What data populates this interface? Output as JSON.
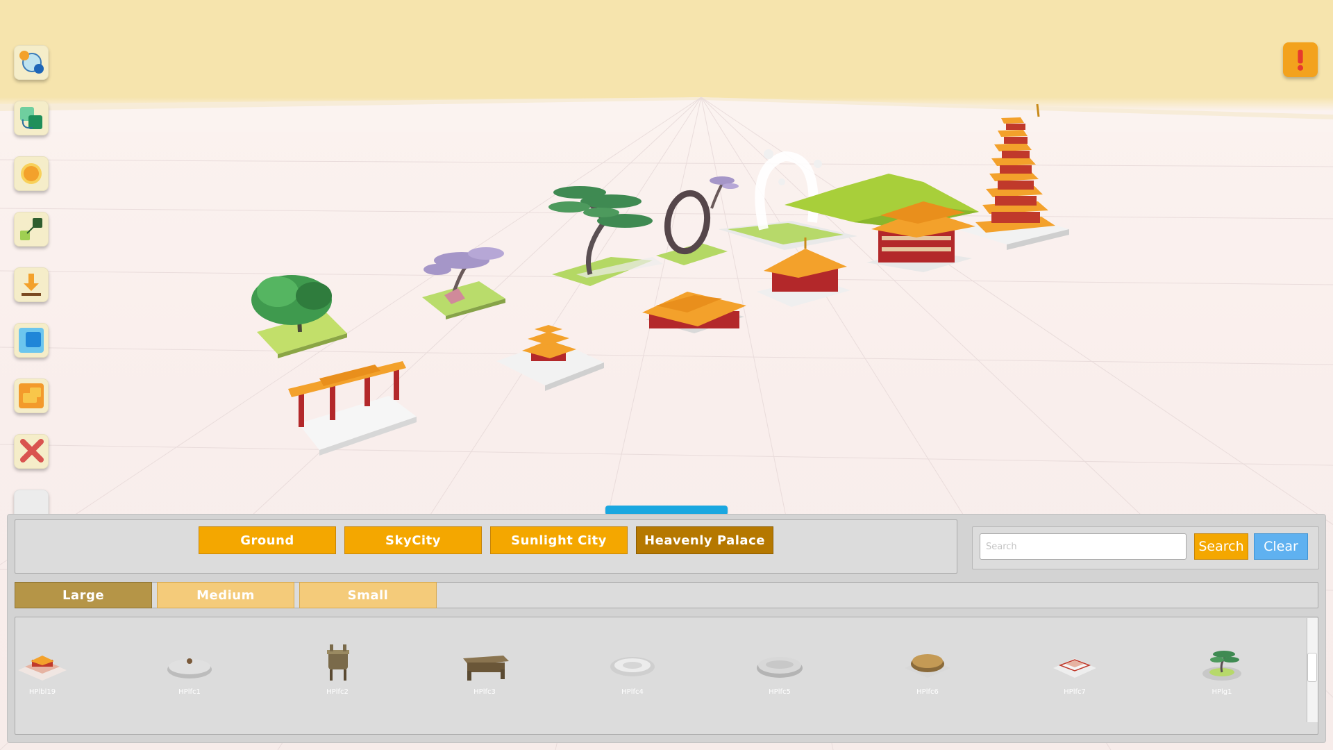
{
  "toolbar": {
    "tools": [
      {
        "icon": "orbit-camera-icon"
      },
      {
        "icon": "move-camera-icon"
      },
      {
        "icon": "sun-icon"
      },
      {
        "icon": "scale-icon"
      },
      {
        "icon": "download-icon"
      },
      {
        "icon": "blue-block-icon"
      },
      {
        "icon": "orange-block-icon"
      },
      {
        "icon": "delete-icon"
      },
      {
        "icon": "blank-tool-icon"
      }
    ],
    "alert_icon": "exclamation-icon"
  },
  "categories": {
    "items": [
      "Ground",
      "SkyCity",
      "Sunlight City",
      "Heavenly Palace"
    ],
    "active": "Heavenly Palace"
  },
  "search": {
    "placeholder": "Search",
    "value": "",
    "search_label": "Search",
    "clear_label": "Clear"
  },
  "sizes": {
    "items": [
      "Large",
      "Medium",
      "Small"
    ],
    "active": "Large"
  },
  "assets": [
    {
      "label": "HPlbl19",
      "icon": "stepped-platform-icon"
    },
    {
      "label": "HPlfc1",
      "icon": "round-base-icon"
    },
    {
      "label": "HPlfc2",
      "icon": "bronze-ding-icon"
    },
    {
      "label": "HPlfc3",
      "icon": "bronze-trough-icon"
    },
    {
      "label": "HPlfc4",
      "icon": "round-dish-icon"
    },
    {
      "label": "HPlfc5",
      "icon": "round-plinth-icon"
    },
    {
      "label": "HPlfc6",
      "icon": "bronze-drum-icon"
    },
    {
      "label": "HPlfc7",
      "icon": "terrace-icon"
    },
    {
      "label": "HPlg1",
      "icon": "bonsai-pine-icon"
    }
  ],
  "colors": {
    "category_button": "#f4a700",
    "category_active": "#b57800",
    "size_button": "#f4cb7a",
    "size_active": "#b59547",
    "clear_button": "#5fb1f0",
    "handle": "#1aa7e0",
    "sky": "#f6e4ad"
  }
}
